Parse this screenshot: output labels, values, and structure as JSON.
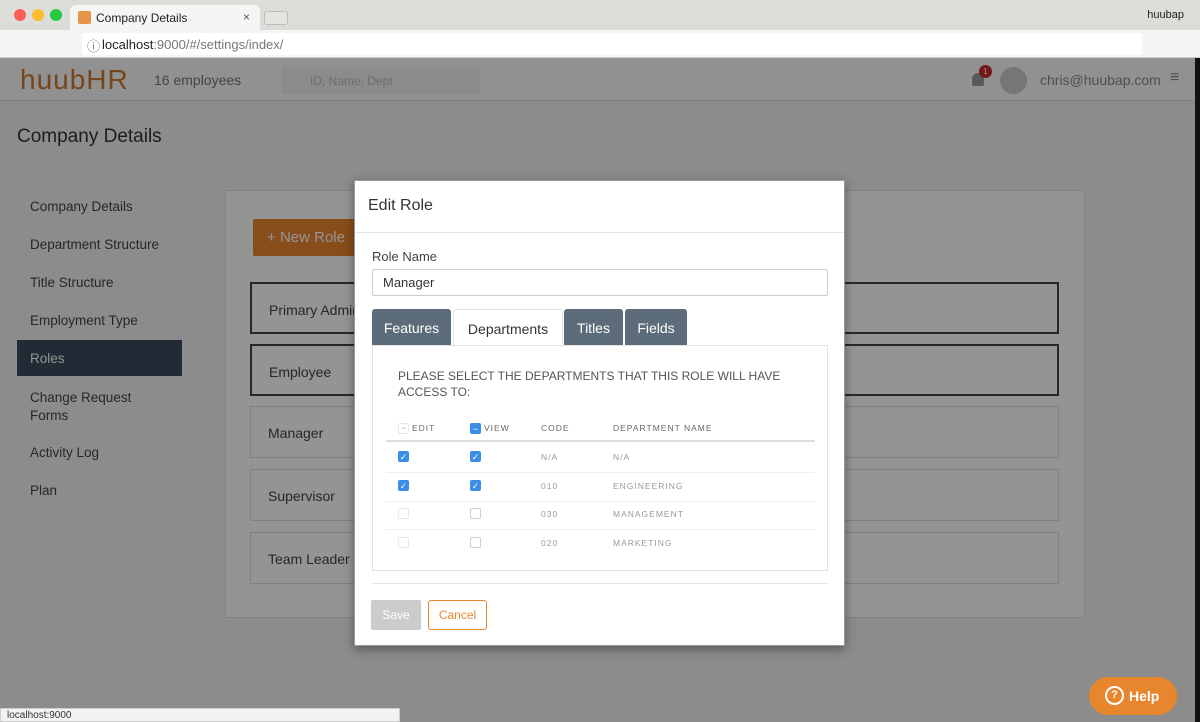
{
  "browser": {
    "tab_title": "Company Details",
    "profile": "huubap",
    "url_host": "localhost",
    "url_path": ":9000/#/settings/index/",
    "status_url": "localhost:9000"
  },
  "header": {
    "logo": "huubHR",
    "employee_count": "16 employees",
    "search_placeholder": "ID, Name, Dept",
    "notification_count": "1",
    "user_email": "chris@huubap.com"
  },
  "page": {
    "title": "Company Details",
    "new_role_label": "New Role",
    "help_label": "Help"
  },
  "sidebar": {
    "items": [
      {
        "label": "Company Details"
      },
      {
        "label": "Department Structure"
      },
      {
        "label": "Title Structure"
      },
      {
        "label": "Employment Type"
      },
      {
        "label": "Roles"
      },
      {
        "label": "Change Request Forms"
      },
      {
        "label": "Activity Log"
      },
      {
        "label": "Plan"
      }
    ]
  },
  "roles": [
    {
      "label": "Primary Admin"
    },
    {
      "label": "Employee"
    },
    {
      "label": "Manager"
    },
    {
      "label": "Supervisor"
    },
    {
      "label": "Team Leader"
    }
  ],
  "modal": {
    "title": "Edit Role",
    "role_name_label": "Role Name",
    "role_name_value": "Manager",
    "tabs": [
      {
        "label": "Features"
      },
      {
        "label": "Departments"
      },
      {
        "label": "Titles"
      },
      {
        "label": "Fields"
      }
    ],
    "instructions": "PLEASE SELECT THE DEPARTMENTS THAT THIS ROLE WILL HAVE ACCESS TO:",
    "columns": {
      "edit": "EDIT",
      "view": "VIEW",
      "code": "CODE",
      "name": "DEPARTMENT NAME"
    },
    "rows": [
      {
        "code": "N/A",
        "name": "N/A",
        "edit": true,
        "view": true
      },
      {
        "code": "010",
        "name": "ENGINEERING",
        "edit": true,
        "view": true
      },
      {
        "code": "030",
        "name": "MANAGEMENT",
        "edit": false,
        "view": false
      },
      {
        "code": "020",
        "name": "MARKETING",
        "edit": false,
        "view": false
      }
    ],
    "save_label": "Save",
    "cancel_label": "Cancel"
  },
  "colors": {
    "accent": "#e8862d",
    "tab_dark": "#5c6c7a",
    "checkbox": "#3a8ee6"
  }
}
